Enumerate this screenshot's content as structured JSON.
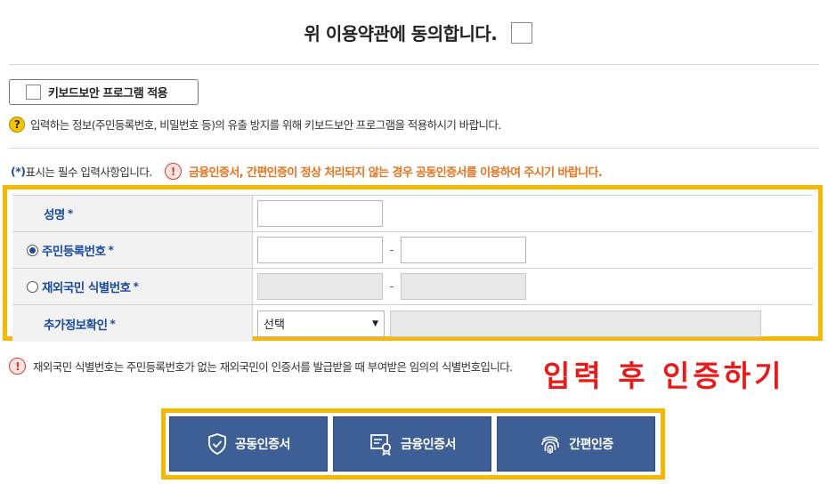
{
  "agree": {
    "text": "위 이용약관에 동의합니다."
  },
  "keyboard_security": {
    "button_label": "키보드보안 프로그램 적용",
    "note": "입력하는 정보(주민등록번호, 비밀번호 등)의 유출 방지를 위해 키보드보안 프로그램을 적용하시기 바랍니다."
  },
  "notice": {
    "required_star": "(*)",
    "required_text": "표시는 필수 입력사항입니다.",
    "warning": "금융인증서, 간편인증이 정상 처리되지 않는 경우 공동인증서를 이용하여 주시기 바랍니다."
  },
  "form": {
    "name_label": "성명",
    "resident_label": "주민등록번호",
    "foreign_label": "재외국민 식별번호",
    "extra_label": "추가정보확인",
    "required_mark": "*",
    "dash": "-",
    "select_value": "선택",
    "resident_selected": true
  },
  "foreign_note": "재외국민 식별번호는 주민등록번호가 없는 재외국민이 인증서를 발급받을 때 부여받은 임의의 식별번호입니다.",
  "big_hint": "입력 후 인증하기",
  "auth_buttons": {
    "joint": "공동인증서",
    "financial": "금융인증서",
    "simple": "간편인증"
  },
  "colors": {
    "accent_frame": "#f6b800",
    "button_bg": "#3d5f95",
    "warning": "#e8721c",
    "label_blue": "#1b4aa0",
    "hint_red": "#e81b1b"
  }
}
